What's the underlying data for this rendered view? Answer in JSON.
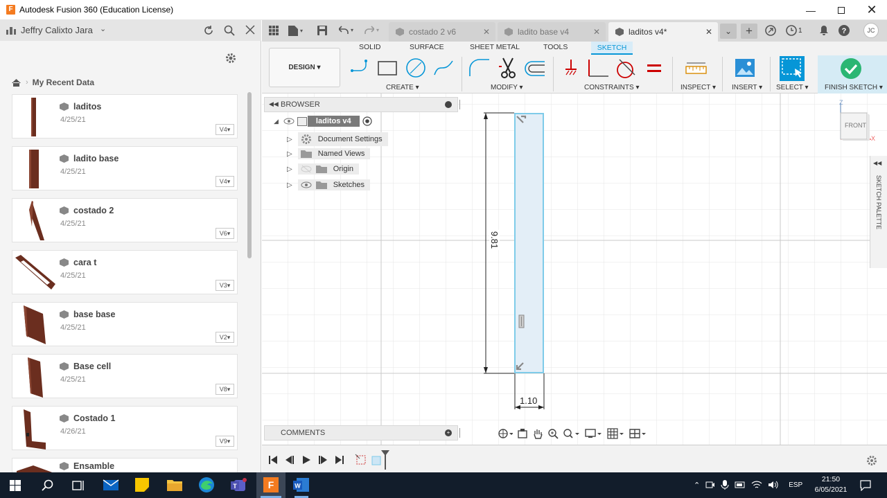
{
  "window": {
    "title": "Autodesk Fusion 360 (Education License)",
    "app_icon": "F"
  },
  "left_panel": {
    "user": "Jeffry Calixto Jara",
    "breadcrumb": "My Recent Data",
    "items": [
      {
        "name": "laditos",
        "date": "4/25/21",
        "version": "V4"
      },
      {
        "name": "ladito base",
        "date": "4/25/21",
        "version": "V4"
      },
      {
        "name": "costado 2",
        "date": "4/25/21",
        "version": "V6"
      },
      {
        "name": "cara t",
        "date": "4/25/21",
        "version": "V3"
      },
      {
        "name": "base base",
        "date": "4/25/21",
        "version": "V2"
      },
      {
        "name": "Base cell",
        "date": "4/25/21",
        "version": "V8"
      },
      {
        "name": "Costado 1",
        "date": "4/26/21",
        "version": "V9"
      },
      {
        "name": "Ensamble",
        "date": "",
        "version": ""
      }
    ]
  },
  "doc_tabs": [
    {
      "label": "costado 2 v6"
    },
    {
      "label": "ladito base v4"
    },
    {
      "label": "laditos v4*"
    }
  ],
  "header_right": {
    "clock_count": "1",
    "avatar": "JC"
  },
  "toolbar": {
    "workspace": "DESIGN",
    "tabs": [
      "SOLID",
      "SURFACE",
      "SHEET METAL",
      "TOOLS",
      "SKETCH"
    ],
    "groups": {
      "create": "CREATE",
      "modify": "MODIFY",
      "constraints": "CONSTRAINTS",
      "inspect": "INSPECT",
      "insert": "INSERT",
      "select": "SELECT",
      "finish": "FINISH SKETCH"
    }
  },
  "browser": {
    "title": "BROWSER",
    "root": "laditos v4",
    "nodes": [
      "Document Settings",
      "Named Views",
      "Origin",
      "Sketches"
    ]
  },
  "comments": {
    "title": "COMMENTS"
  },
  "sketch": {
    "height_dim": "9.81",
    "width_dim": "1.10"
  },
  "viewcube": {
    "face": "FRONT",
    "z_axis": "Z",
    "x_axis": "X"
  },
  "sketch_palette": {
    "label": "SKETCH PALETTE"
  },
  "taskbar": {
    "time": "21:50",
    "date": "6/05/2021",
    "lang": "ESP"
  },
  "colors": {
    "accent_blue": "#0696d7",
    "finish_green": "#2bb673",
    "wood": "#6b2e1f"
  }
}
